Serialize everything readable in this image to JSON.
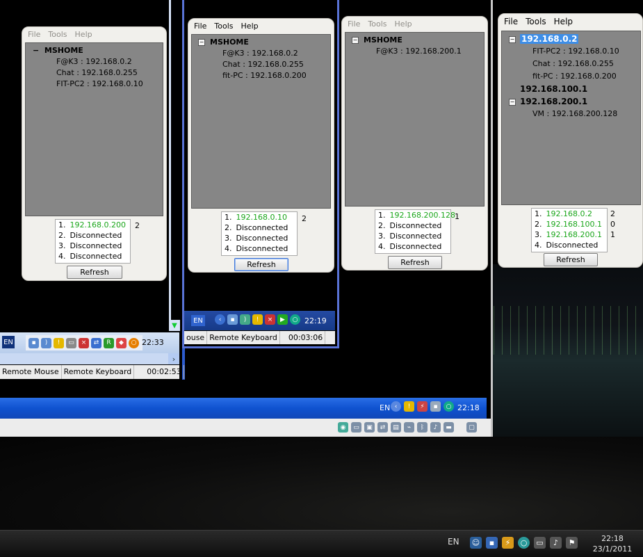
{
  "gadget_menu": [
    "File",
    "Tools",
    "Help"
  ],
  "refresh_label": "Refresh",
  "gadgets": [
    {
      "menu_enabled": false,
      "tree": [
        {
          "label": "MSHOME",
          "bold": true,
          "expander": "−"
        },
        {
          "label": "F@K3 : 192.168.0.2"
        },
        {
          "label": "Chat : 192.168.0.255"
        },
        {
          "label": "FIT-PC2 : 192.168.0.10"
        }
      ],
      "connections": [
        {
          "index": "1.",
          "value": "192.168.0.200",
          "color": "#1aa61a"
        },
        {
          "index": "2.",
          "value": "Disconnected",
          "color": "#000000"
        },
        {
          "index": "3.",
          "value": "Disconnected",
          "color": "#000000"
        },
        {
          "index": "4.",
          "value": "Disconnected",
          "color": "#000000"
        }
      ],
      "counts": [
        "2"
      ]
    },
    {
      "menu_enabled": true,
      "tree": [
        {
          "label": "MSHOME",
          "bold": true,
          "expander": "−"
        },
        {
          "label": "F@K3 : 192.168.0.2"
        },
        {
          "label": "Chat : 192.168.0.255"
        },
        {
          "label": "fit-PC : 192.168.0.200"
        }
      ],
      "connections": [
        {
          "index": "1.",
          "value": "192.168.0.10",
          "color": "#1aa61a"
        },
        {
          "index": "2.",
          "value": "Disconnected",
          "color": "#000000"
        },
        {
          "index": "3.",
          "value": "Disconnected",
          "color": "#000000"
        },
        {
          "index": "4.",
          "value": "Disconnected",
          "color": "#000000"
        }
      ],
      "counts": [
        "2"
      ]
    },
    {
      "menu_enabled": false,
      "tree": [
        {
          "label": "MSHOME",
          "bold": true,
          "expander": "−"
        },
        {
          "label": "F@K3 : 192.168.200.1"
        }
      ],
      "connections": [
        {
          "index": "1.",
          "value": "192.168.200.128",
          "color": "#1aa61a"
        },
        {
          "index": "2.",
          "value": "Disconnected",
          "color": "#000000"
        },
        {
          "index": "3.",
          "value": "Disconnected",
          "color": "#000000"
        },
        {
          "index": "4.",
          "value": "Disconnected",
          "color": "#000000"
        }
      ],
      "counts": [
        "1"
      ]
    },
    {
      "menu_enabled": true,
      "tree": [
        {
          "label": "192.168.0.2",
          "bold": true,
          "expander": "−",
          "selected": true
        },
        {
          "label": "FIT-PC2 : 192.168.0.10"
        },
        {
          "label": "Chat : 192.168.0.255"
        },
        {
          "label": "fit-PC : 192.168.0.200"
        },
        {
          "label": "192.168.100.1",
          "bold": true
        },
        {
          "label": "192.168.200.1",
          "bold": true,
          "expander": "−"
        },
        {
          "label": "VM : 192.168.200.128"
        }
      ],
      "connections": [
        {
          "index": "1.",
          "value": "192.168.0.2",
          "color": "#1aa61a"
        },
        {
          "index": "2.",
          "value": "192.168.100.1",
          "color": "#1aa61a"
        },
        {
          "index": "3.",
          "value": "192.168.200.1",
          "color": "#1aa61a"
        },
        {
          "index": "4.",
          "value": "Disconnected",
          "color": "#000000"
        }
      ],
      "counts": [
        "2",
        "0",
        "1"
      ]
    }
  ],
  "left_window": {
    "lang": "EN",
    "time": "22:33",
    "status": [
      "Remote Mouse",
      "Remote Keyboard",
      "00:02:53"
    ]
  },
  "middle_window": {
    "lang": "EN",
    "time": "22:19",
    "status": [
      "ouse",
      "Remote Keyboard",
      "00:03:06"
    ]
  },
  "host_window": {
    "lang": "EN",
    "time": "22:18"
  },
  "taskbar": {
    "lang": "EN",
    "time": "22:18",
    "date": "23/1/2011"
  }
}
